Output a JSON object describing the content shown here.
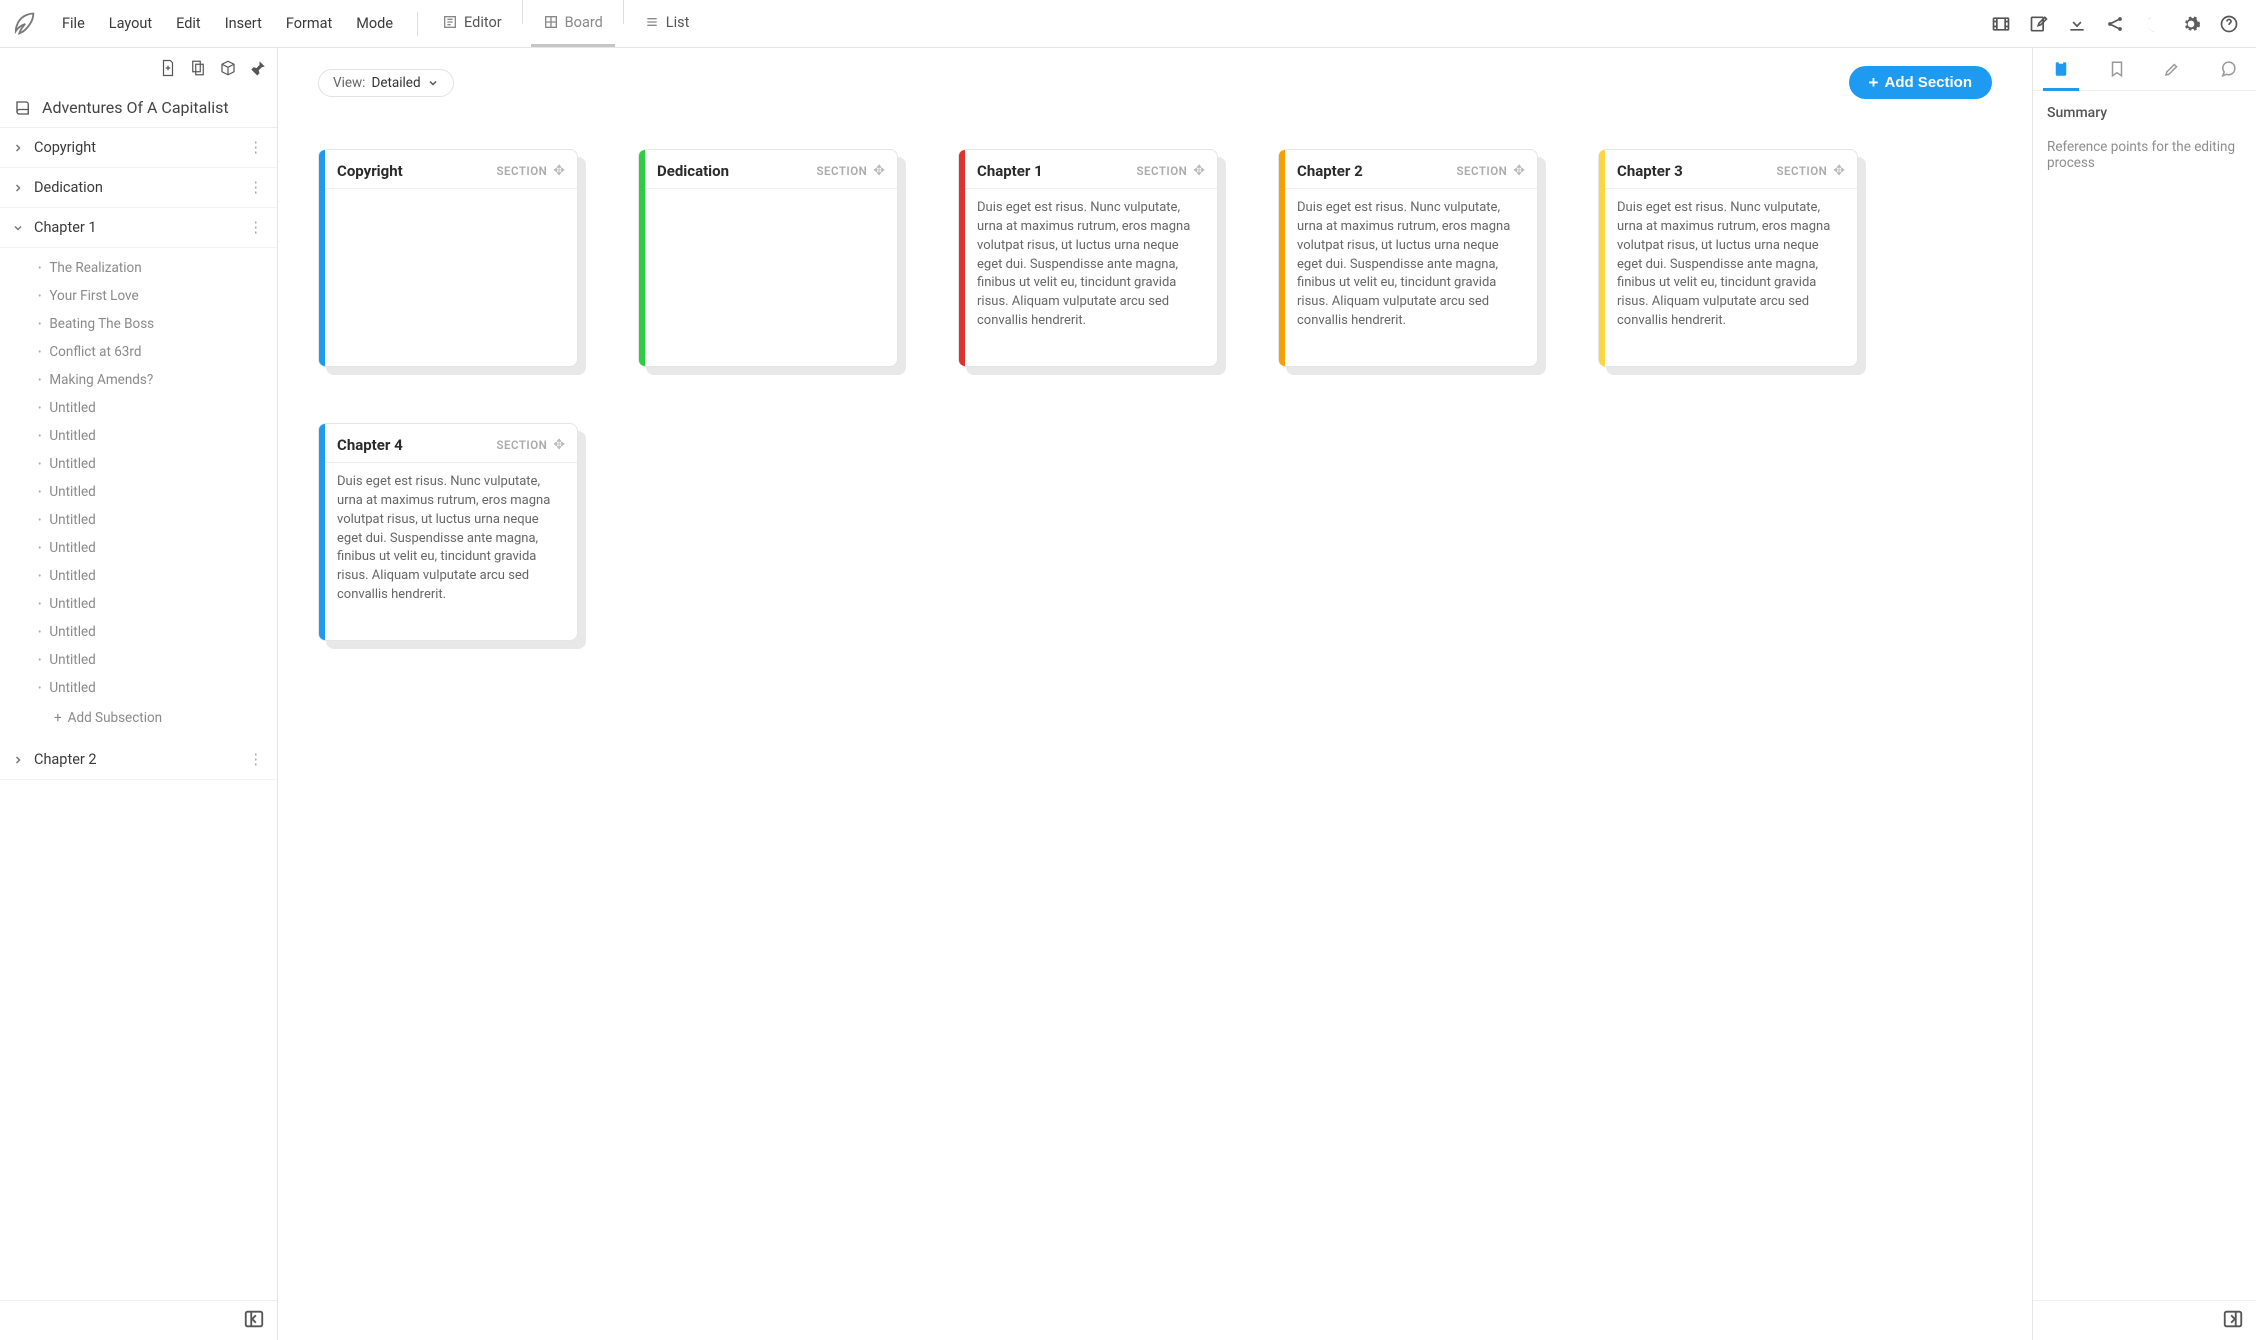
{
  "menubar": {
    "items": [
      "File",
      "Layout",
      "Edit",
      "Insert",
      "Format",
      "Mode"
    ],
    "viewTabs": [
      {
        "label": "Editor",
        "active": false
      },
      {
        "label": "Board",
        "active": true
      },
      {
        "label": "List",
        "active": false
      }
    ]
  },
  "sidebar": {
    "manuscriptTitle": "Adventures Of A Capitalist",
    "addSubsection": "Add Subsection",
    "sections": [
      {
        "label": "Copyright",
        "expanded": false,
        "children": []
      },
      {
        "label": "Dedication",
        "expanded": false,
        "children": []
      },
      {
        "label": "Chapter 1",
        "expanded": true,
        "children": [
          "The Realization",
          "Your First Love",
          "Beating The Boss",
          "Conflict at 63rd",
          "Making Amends?",
          "Untitled",
          "Untitled",
          "Untitled",
          "Untitled",
          "Untitled",
          "Untitled",
          "Untitled",
          "Untitled",
          "Untitled",
          "Untitled",
          "Untitled"
        ]
      },
      {
        "label": "Chapter 2",
        "expanded": false,
        "children": []
      }
    ]
  },
  "board": {
    "viewLabel": "View:",
    "viewValue": "Detailed",
    "addSection": "Add Section",
    "sectionType": "SECTION",
    "lorem": "Duis eget est risus. Nunc vulputate, urna at maximus rutrum, eros magna volutpat risus, ut luctus urna neque eget dui. Suspendisse ante magna, finibus ut velit eu, tincidunt gravida risus. Aliquam vulputate arcu sed convallis hendrerit.",
    "cards": [
      {
        "title": "Copyright",
        "color": "c-blue",
        "body": ""
      },
      {
        "title": "Dedication",
        "color": "c-green",
        "body": ""
      },
      {
        "title": "Chapter 1",
        "color": "c-red",
        "body": "lorem"
      },
      {
        "title": "Chapter 2",
        "color": "c-orange",
        "body": "lorem"
      },
      {
        "title": "Chapter 3",
        "color": "c-yellow",
        "body": "lorem"
      },
      {
        "title": "Chapter 4",
        "color": "c-blue2",
        "body": "lorem"
      }
    ]
  },
  "rightPanel": {
    "title": "Summary",
    "desc": "Reference points for the editing process"
  }
}
